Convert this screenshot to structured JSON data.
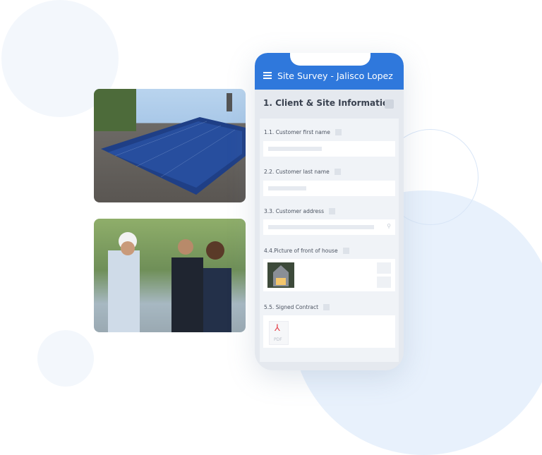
{
  "header": {
    "title": "Site Survey - Jalisco Lopez",
    "menu_icon": "hamburger-icon",
    "color": "#2f78dc"
  },
  "section": {
    "title": "1. Client & Site Information"
  },
  "fields": [
    {
      "label": "1.1. Customer first name"
    },
    {
      "label": "2.2. Customer last name"
    },
    {
      "label": "3.3. Customer address",
      "icon": "location-pin-icon"
    },
    {
      "label": "4.4.Picture of front of house"
    },
    {
      "label": "5.5. Signed Contract",
      "file_label": "PDF"
    }
  ]
}
